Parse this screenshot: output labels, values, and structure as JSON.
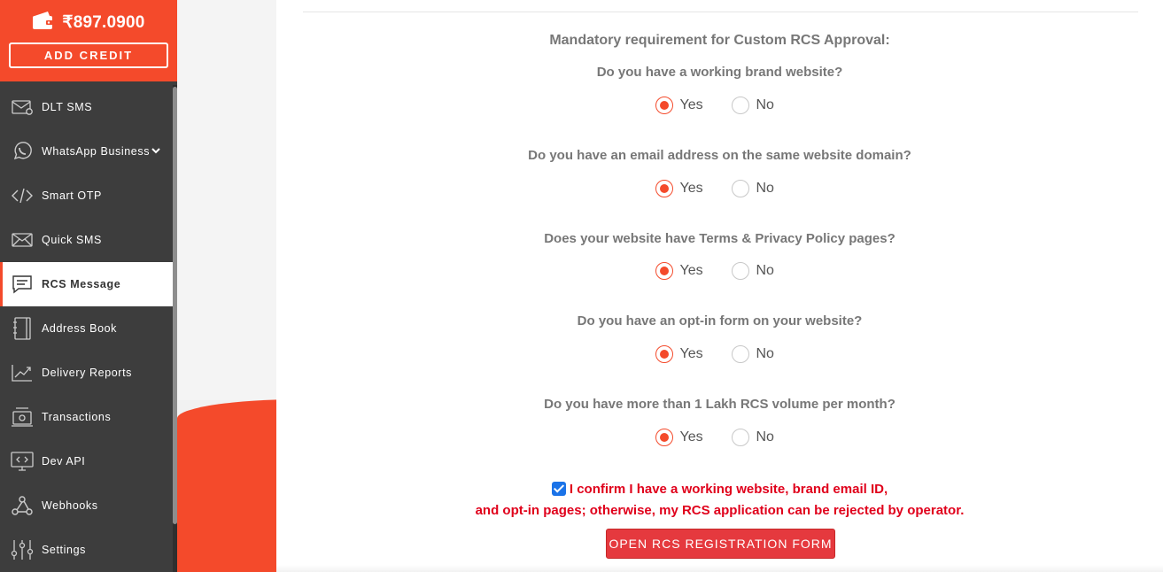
{
  "wallet": {
    "balance": "₹897.0900",
    "add_credit_label": "ADD CREDIT"
  },
  "sidebar": {
    "items": [
      {
        "label": "DLT SMS",
        "icon": "envelope-icon"
      },
      {
        "label": "WhatsApp Business",
        "icon": "whatsapp-icon"
      },
      {
        "label": "Smart OTP",
        "icon": "code-icon"
      },
      {
        "label": "Quick SMS",
        "icon": "send-mail-icon"
      },
      {
        "label": "RCS Message",
        "icon": "chat-icon",
        "active": true
      },
      {
        "label": "Address Book",
        "icon": "address-book-icon"
      },
      {
        "label": "Delivery Reports",
        "icon": "chart-icon"
      },
      {
        "label": "Transactions",
        "icon": "money-icon"
      },
      {
        "label": "Dev API",
        "icon": "monitor-code-icon"
      },
      {
        "label": "Webhooks",
        "icon": "webhook-icon"
      },
      {
        "label": "Settings",
        "icon": "sliders-icon"
      }
    ]
  },
  "form": {
    "heading": "Mandatory requirement for Custom RCS Approval:",
    "questions": [
      {
        "text": "Do you have a working brand website?",
        "selected": "Yes"
      },
      {
        "text": "Do you have an email address on the same website domain?",
        "selected": "Yes"
      },
      {
        "text": "Does your website have Terms & Privacy Policy pages?",
        "selected": "Yes"
      },
      {
        "text": "Do you have an opt-in form on your website?",
        "selected": "Yes"
      },
      {
        "text": "Do you have more than 1 Lakh RCS volume per month?",
        "selected": "Yes"
      }
    ],
    "yes_label": "Yes",
    "no_label": "No",
    "confirm_line1": "I confirm I have a working website, brand email ID,",
    "confirm_line2": "and opt-in pages; otherwise, my RCS application can be rejected by operator.",
    "confirm_checked": true,
    "open_button_label": "OPEN RCS REGISTRATION FORM"
  },
  "colors": {
    "accent": "#f44a2b",
    "sidebar_bg": "#3d3d3d",
    "confirm_text": "#e0001b",
    "button_bg": "#e5393e"
  }
}
